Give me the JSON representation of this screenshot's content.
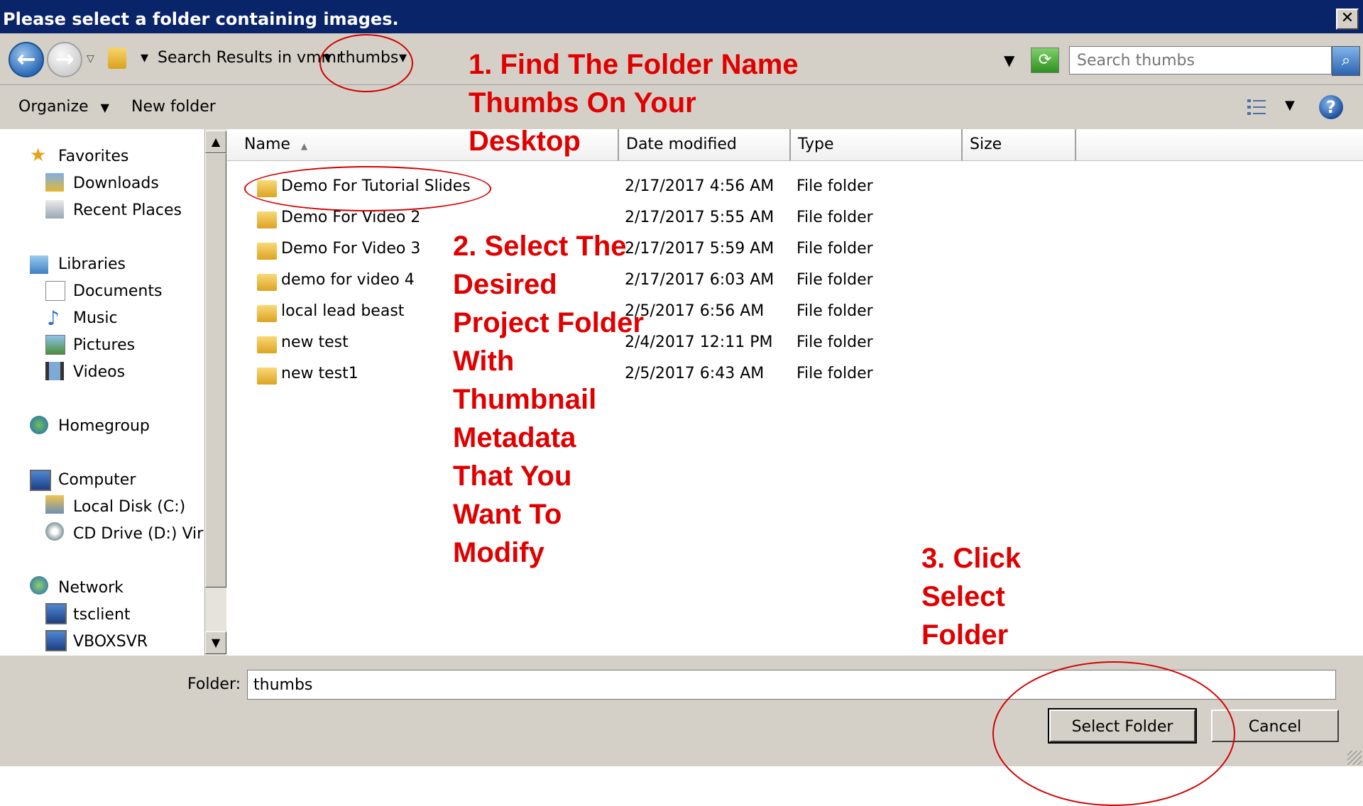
{
  "window": {
    "title": "Please select a folder containing images.",
    "close_label": "✕"
  },
  "address": {
    "breadcrumb": [
      "Search Results in vmmr",
      "thumbs"
    ],
    "search_placeholder": "Search thumbs"
  },
  "toolbar": {
    "organize_label": "Organize",
    "new_folder_label": "New folder"
  },
  "nav": {
    "groups": [
      {
        "label": "Favorites",
        "icon": "star-icon",
        "items": [
          {
            "label": "Downloads",
            "icon": "downloads-folder-icon"
          },
          {
            "label": "Recent Places",
            "icon": "recent-places-icon"
          }
        ]
      },
      {
        "label": "Libraries",
        "icon": "libraries-icon",
        "items": [
          {
            "label": "Documents",
            "icon": "document-icon"
          },
          {
            "label": "Music",
            "icon": "music-icon"
          },
          {
            "label": "Pictures",
            "icon": "pictures-icon"
          },
          {
            "label": "Videos",
            "icon": "videos-icon"
          }
        ]
      },
      {
        "label": "Homegroup",
        "icon": "homegroup-icon",
        "items": []
      },
      {
        "label": "Computer",
        "icon": "computer-icon",
        "items": [
          {
            "label": "Local Disk (C:)",
            "icon": "local-disk-icon"
          },
          {
            "label": "CD Drive (D:) Virtu",
            "icon": "cd-drive-icon"
          }
        ]
      },
      {
        "label": "Network",
        "icon": "network-icon",
        "items": [
          {
            "label": "tsclient",
            "icon": "network-computer-icon"
          },
          {
            "label": "VBOXSVR",
            "icon": "network-computer-icon"
          }
        ]
      }
    ]
  },
  "columns": [
    "Name",
    "Date modified",
    "Type",
    "Size"
  ],
  "files": [
    {
      "name": "Demo For Tutorial Slides",
      "date": "2/17/2017 4:56 AM",
      "type": "File folder"
    },
    {
      "name": "Demo For Video 2",
      "date": "2/17/2017 5:55 AM",
      "type": "File folder"
    },
    {
      "name": "Demo For Video 3",
      "date": "2/17/2017 5:59 AM",
      "type": "File folder"
    },
    {
      "name": "demo for video 4",
      "date": "2/17/2017 6:03 AM",
      "type": "File folder"
    },
    {
      "name": "local lead beast",
      "date": "2/5/2017 6:56 AM",
      "type": "File folder"
    },
    {
      "name": "new test",
      "date": "2/4/2017 12:11 PM",
      "type": "File folder"
    },
    {
      "name": "new test1",
      "date": "2/5/2017 6:43 AM",
      "type": "File folder"
    }
  ],
  "bottom": {
    "folder_label": "Folder:",
    "folder_value": "thumbs",
    "select_label": "Select Folder",
    "cancel_label": "Cancel"
  },
  "annotations": {
    "step1": [
      "1. Find The Folder Name",
      "Thumbs On Your",
      "Desktop"
    ],
    "step2": [
      "2. Select The",
      "Desired",
      "Project Folder",
      "With",
      "Thumbnail",
      "Metadata",
      "That You",
      "Want To",
      "Modify"
    ],
    "step3": [
      "3. Click",
      "Select",
      "Folder"
    ]
  },
  "colors": {
    "annotation": "#e00000",
    "titlebar": "#0a246a",
    "chrome": "#d4d0c8"
  }
}
